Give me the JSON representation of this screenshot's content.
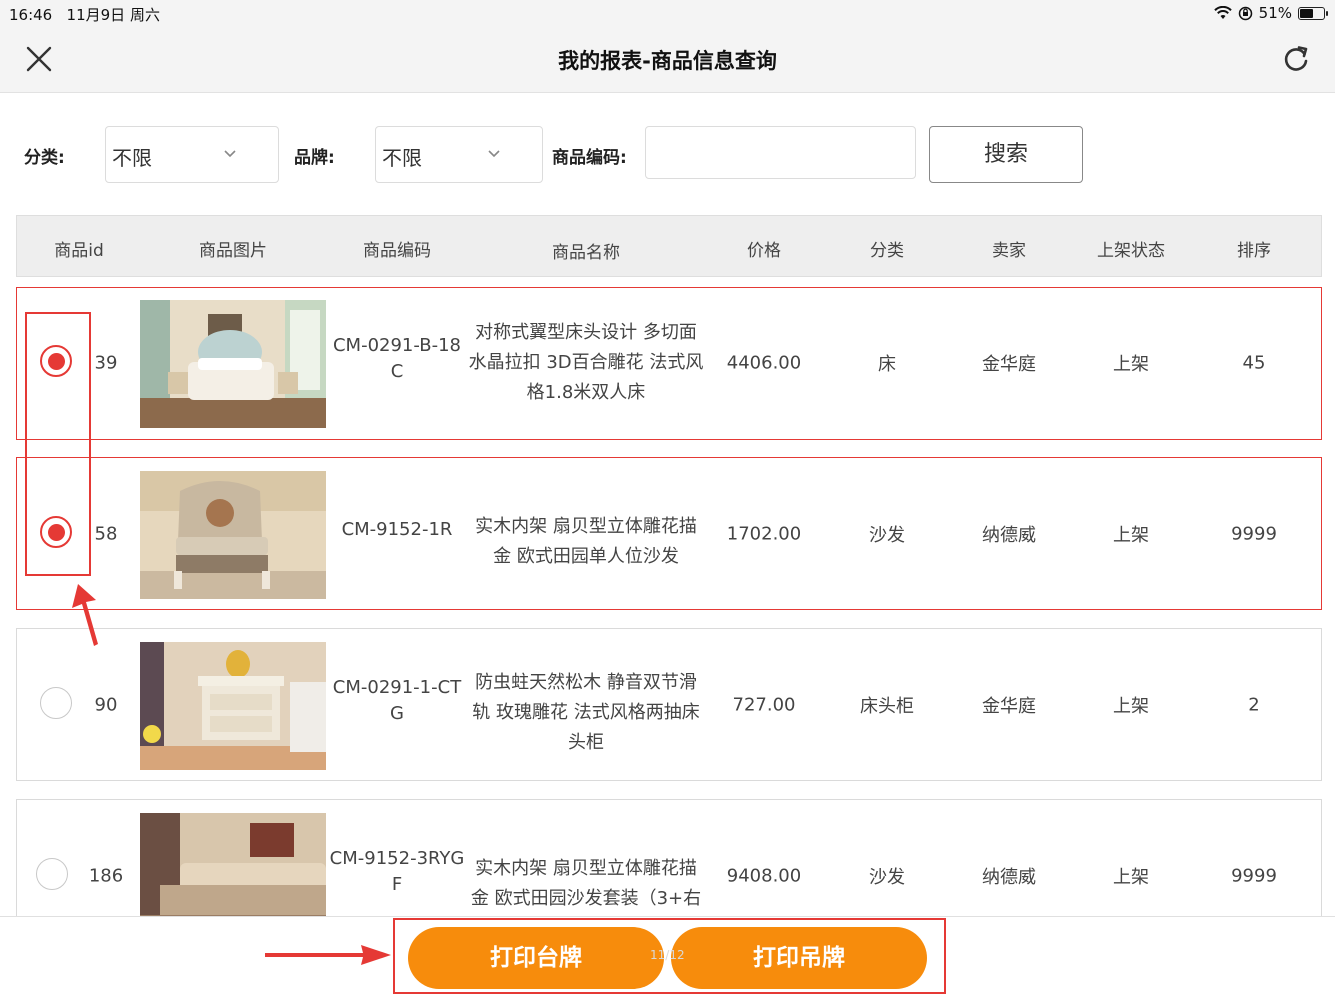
{
  "status_bar": {
    "time": "16:46",
    "date": "11月9日 周六",
    "battery": "51%",
    "battery_level": 0.51
  },
  "nav": {
    "title": "我的报表-商品信息查询",
    "close_icon": "close-icon",
    "refresh_icon": "refresh-icon"
  },
  "filters": {
    "category_label": "分类:",
    "category_value": "不限",
    "brand_label": "品牌:",
    "brand_value": "不限",
    "code_label": "商品编码:",
    "code_value": "",
    "code_placeholder": "",
    "search_label": "搜索"
  },
  "table": {
    "columns": [
      "商品id",
      "商品图片",
      "商品编码",
      "商品名称",
      "价格",
      "分类",
      "卖家",
      "上架状态",
      "排序"
    ],
    "rows": [
      {
        "selected": true,
        "id": "39",
        "image": "bed",
        "code": "CM-0291-B-18C",
        "name": "对称式翼型床头设计 多切面水晶拉扣 3D百合雕花 法式风格1.8米双人床",
        "price": "4406.00",
        "category": "床",
        "seller": "金华庭",
        "status": "上架",
        "sort": "45"
      },
      {
        "selected": true,
        "id": "58",
        "image": "armchair",
        "code": "CM-9152-1R",
        "name": "实木内架 扇贝型立体雕花描金 欧式田园单人位沙发",
        "price": "1702.00",
        "category": "沙发",
        "seller": "纳德威",
        "status": "上架",
        "sort": "9999"
      },
      {
        "selected": false,
        "id": "90",
        "image": "nightstand",
        "code": "CM-0291-1-CTG",
        "name": "防虫蛀天然松木 静音双节滑轨 玫瑰雕花 法式风格两抽床头柜",
        "price": "727.00",
        "category": "床头柜",
        "seller": "金华庭",
        "status": "上架",
        "sort": "2"
      },
      {
        "selected": false,
        "id": "186",
        "image": "sofa-set",
        "code": "CM-9152-3RYGF",
        "name": "实木内架 扇贝型立体雕花描金 欧式田园沙发套装（3+右",
        "price": "9408.00",
        "category": "沙发",
        "seller": "纳德威",
        "status": "上架",
        "sort": "9999"
      }
    ]
  },
  "bottom": {
    "print_table_card": "打印台牌",
    "print_hang_tag": "打印吊牌",
    "pager": "11/12"
  },
  "colors": {
    "accent_orange": "#f78c0c",
    "annotation_red": "#e53935"
  }
}
